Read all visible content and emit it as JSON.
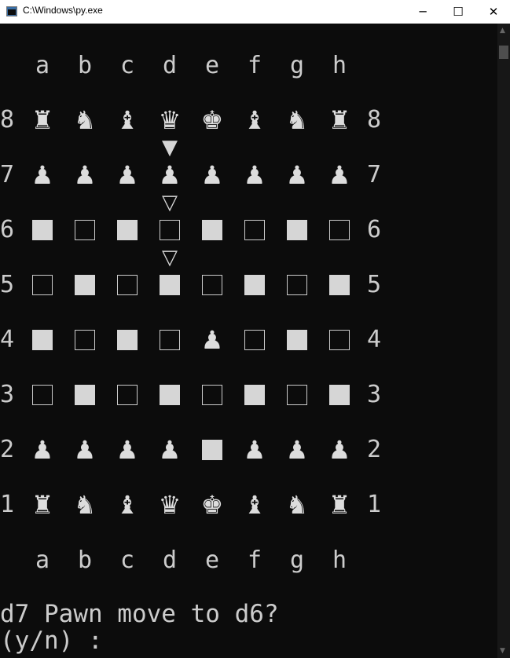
{
  "window": {
    "title": "C:\\Windows\\py.exe",
    "minimize_glyph": "─",
    "maximize_glyph": "☐",
    "close_glyph": "✕"
  },
  "board": {
    "files": [
      "a",
      "b",
      "c",
      "d",
      "e",
      "f",
      "g",
      "h"
    ],
    "ranks": [
      {
        "label": "8",
        "cells": [
          "♜",
          "♞",
          "♝",
          "♛",
          "♚",
          "♝",
          "♞",
          "♜"
        ]
      },
      {
        "label": "7",
        "cells": [
          "♟",
          "♟",
          "♟",
          "♟",
          "♟",
          "♟",
          "♟",
          "♟"
        ]
      },
      {
        "label": "6",
        "cells": [
          "F",
          "E",
          "F",
          "E",
          "F",
          "E",
          "F",
          "E"
        ]
      },
      {
        "label": "5",
        "cells": [
          "E",
          "F",
          "E",
          "F",
          "E",
          "F",
          "E",
          "F"
        ]
      },
      {
        "label": "4",
        "cells": [
          "F",
          "E",
          "F",
          "E",
          "♟",
          "E",
          "F",
          "E"
        ]
      },
      {
        "label": "3",
        "cells": [
          "E",
          "F",
          "E",
          "F",
          "E",
          "F",
          "E",
          "F"
        ]
      },
      {
        "label": "2",
        "cells": [
          "♟",
          "♟",
          "♟",
          "♟",
          "F",
          "♟",
          "♟",
          "♟"
        ]
      },
      {
        "label": "1",
        "cells": [
          "♜",
          "♞",
          "♝",
          "♛",
          "♚",
          "♝",
          "♞",
          "♜"
        ]
      }
    ],
    "markers": [
      {
        "after_rank": "8",
        "file": "d",
        "glyph": "▼"
      },
      {
        "after_rank": "7",
        "file": "d",
        "glyph": "▽"
      },
      {
        "after_rank": "6",
        "file": "d",
        "glyph": "▽"
      }
    ]
  },
  "prompt": {
    "line1": "d7 Pawn move to d6?",
    "line2": "(y/n) :"
  }
}
